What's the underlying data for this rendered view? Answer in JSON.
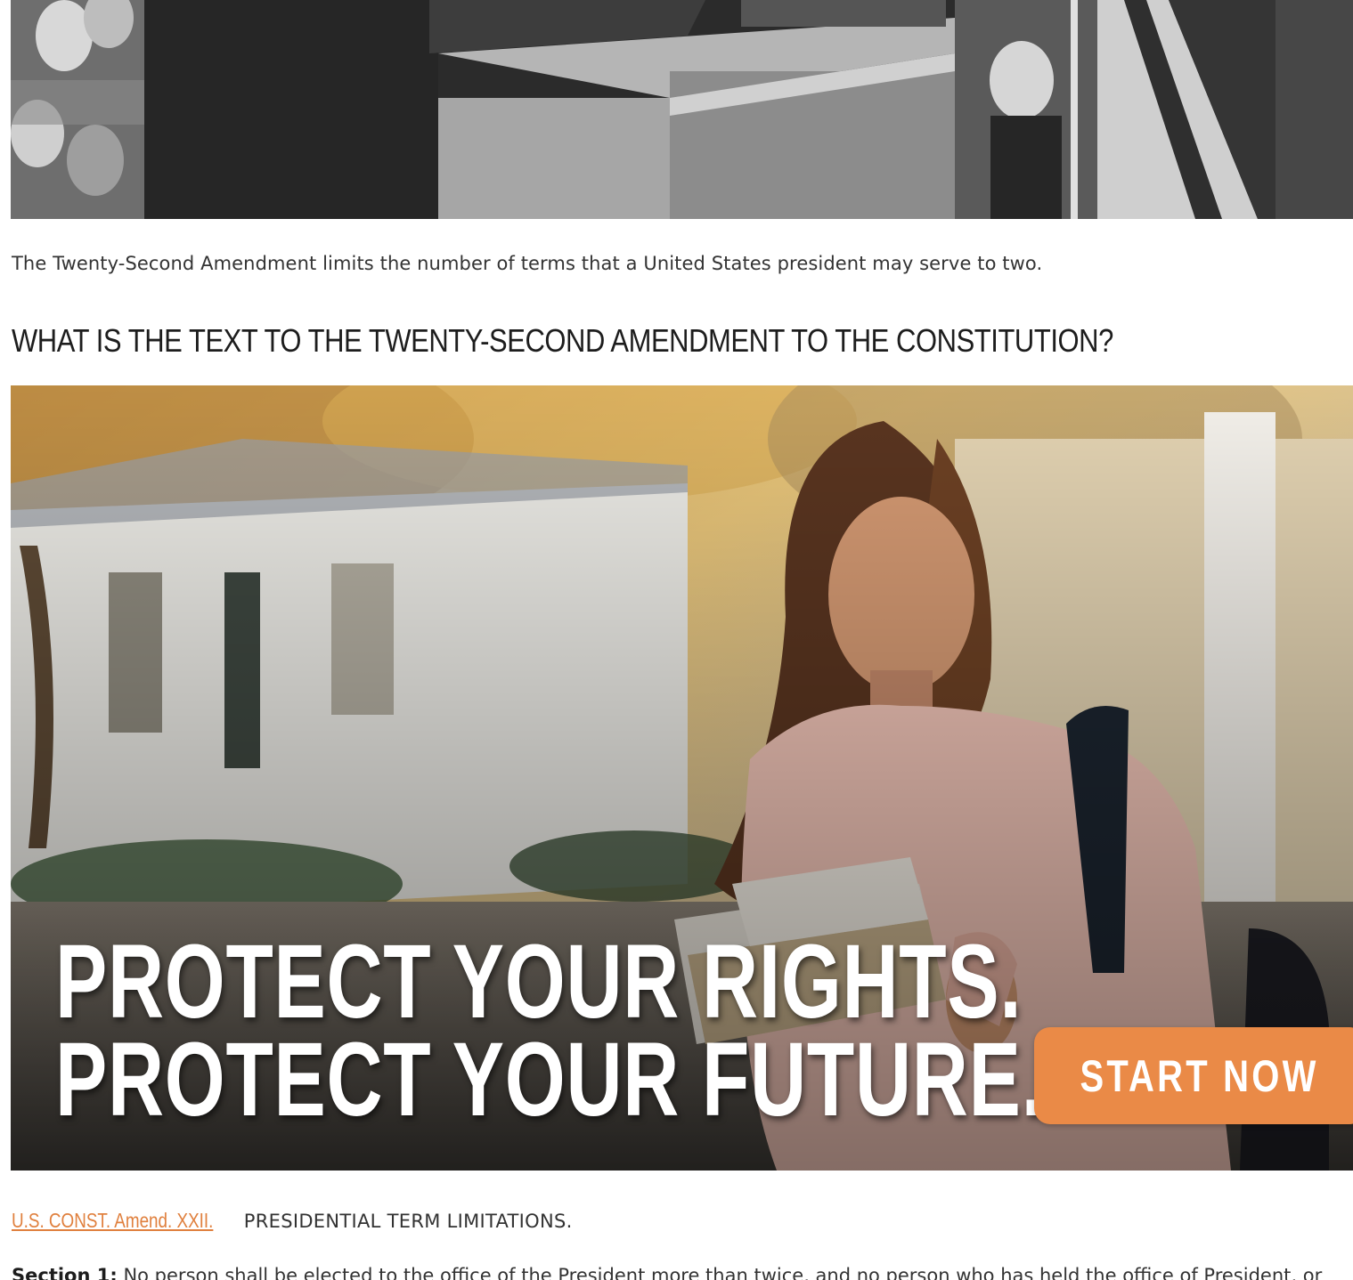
{
  "hero_photo": {
    "description_icon": "black-and-white-photo"
  },
  "caption": "The Twenty-Second Amendment limits the number of terms that a United States president may serve to two.",
  "section_heading": "WHAT IS THE TEXT TO THE TWENTY-SECOND AMENDMENT TO THE CONSTITUTION?",
  "ad": {
    "headline_line1": "PROTECT YOUR RIGHTS.",
    "headline_line2": "PROTECT YOUR FUTURE.",
    "cta_label": "START NOW",
    "cta_color": "#ea8a47"
  },
  "citation": {
    "link_text": "U.S. CONST. Amend. XXII.",
    "rest_text": "PRESIDENTIAL TERM LIMITATIONS.",
    "link_color": "#e0803e"
  },
  "section1": {
    "label": "Section 1:",
    "text": "No person shall be elected to the office of the President more than twice, and no person who has held the office of President, or"
  }
}
